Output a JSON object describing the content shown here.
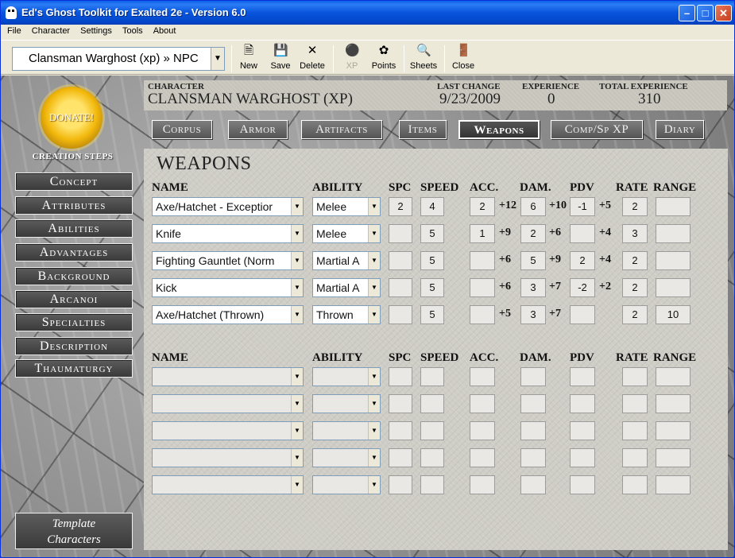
{
  "window": {
    "title": "Ed's Ghost Toolkit for Exalted 2e - Version 6.0"
  },
  "menu": [
    "File",
    "Character",
    "Settings",
    "Tools",
    "About"
  ],
  "toolbar": {
    "character_select": "Clansman Warghost (xp) » NPC",
    "buttons": {
      "new": "New",
      "save": "Save",
      "delete": "Delete",
      "xp": "XP",
      "points": "Points",
      "sheets": "Sheets",
      "close": "Close"
    }
  },
  "sidebar": {
    "donate": "DONATE!",
    "steps_title": "CREATION STEPS",
    "steps": [
      "Concept",
      "Attributes",
      "Abilities",
      "Advantages",
      "Background",
      "Arcanoi",
      "Specialties",
      "Description",
      "Thaumaturgy"
    ],
    "template_line1": "Template",
    "template_line2": "Characters"
  },
  "header": {
    "character_label": "CHARACTER",
    "character_value": "CLANSMAN WARGHOST (XP)",
    "last_change_label": "LAST CHANGE",
    "last_change_value": "9/23/2009",
    "experience_label": "EXPERIENCE",
    "experience_value": "0",
    "total_experience_label": "TOTAL EXPERIENCE",
    "total_experience_value": "310"
  },
  "tabs": [
    "Corpus",
    "Armor",
    "Artifacts",
    "Items",
    "Weapons",
    "Comp/Sp XP",
    "Diary"
  ],
  "active_tab": "Weapons",
  "panel": {
    "title": "WEAPONS",
    "columns": [
      "NAME",
      "ABILITY",
      "SPC",
      "SPEED",
      "ACC.",
      "DAM.",
      "PDV",
      "RATE",
      "RANGE"
    ],
    "weapons": [
      {
        "name": "Axe/Hatchet - Exceptior",
        "ability": "Melee",
        "spc": "2",
        "speed": "4",
        "acc": "2",
        "acc_bonus": "+12",
        "dam": "6",
        "dam_bonus": "+10",
        "pdv": "-1",
        "pdv_bonus": "+5",
        "rate": "2",
        "range": ""
      },
      {
        "name": "Knife",
        "ability": "Melee",
        "spc": "",
        "speed": "5",
        "acc": "1",
        "acc_bonus": "+9",
        "dam": "2",
        "dam_bonus": "+6",
        "pdv": "",
        "pdv_bonus": "+4",
        "rate": "3",
        "range": ""
      },
      {
        "name": "Fighting Gauntlet (Norm",
        "ability": "Martial A",
        "spc": "",
        "speed": "5",
        "acc": "",
        "acc_bonus": "+6",
        "dam": "5",
        "dam_bonus": "+9",
        "pdv": "2",
        "pdv_bonus": "+4",
        "rate": "2",
        "range": ""
      },
      {
        "name": "Kick",
        "ability": "Martial A",
        "spc": "",
        "speed": "5",
        "acc": "",
        "acc_bonus": "+6",
        "dam": "3",
        "dam_bonus": "+7",
        "pdv": "-2",
        "pdv_bonus": "+2",
        "rate": "2",
        "range": ""
      },
      {
        "name": "Axe/Hatchet (Thrown)",
        "ability": "Thrown",
        "spc": "",
        "speed": "5",
        "acc": "",
        "acc_bonus": "+5",
        "dam": "3",
        "dam_bonus": "+7",
        "pdv": "",
        "pdv_bonus": "",
        "rate": "2",
        "range": "10"
      }
    ],
    "empty_rows": 5
  }
}
